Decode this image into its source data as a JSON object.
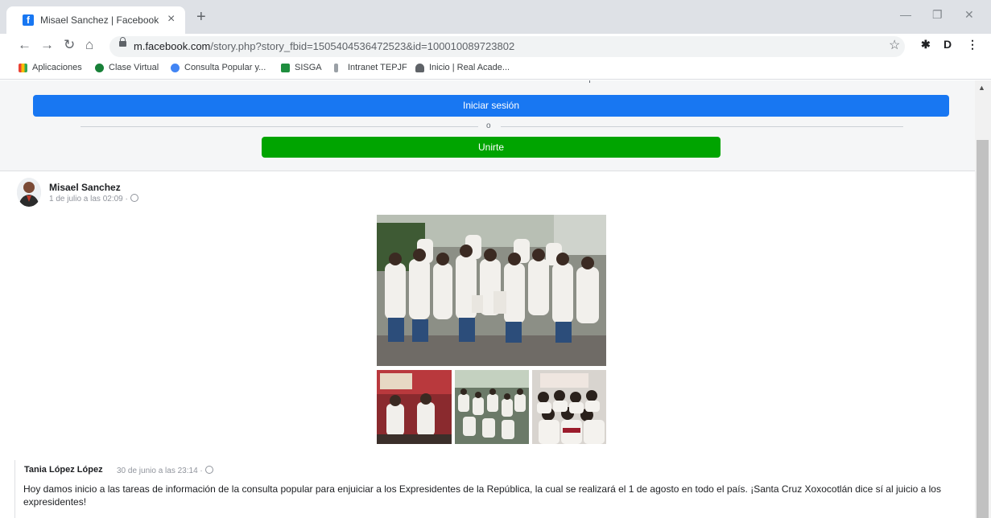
{
  "browser": {
    "tab_title": "Misael Sanchez | Facebook",
    "tab_favicon": "f",
    "url_host": "m.facebook.com",
    "url_path": "/story.php?story_fbid=1505404536472523&id=100010089723802",
    "bookmarks": [
      {
        "label": "Aplicaciones",
        "icon": "apps-grid-icon"
      },
      {
        "label": "Clase Virtual",
        "icon": "classroom-icon"
      },
      {
        "label": "Consulta Popular y...",
        "icon": "globe-icon"
      },
      {
        "label": "SISGA",
        "icon": "sisga-icon"
      },
      {
        "label": "Intranet TEPJF",
        "icon": "tepjf-icon"
      },
      {
        "label": "Inicio | Real Acade...",
        "icon": "rae-icon"
      }
    ],
    "extension_label": "D"
  },
  "login_bar": {
    "login_label": "Iniciar sesión",
    "or_label": "o",
    "join_label": "Unirte",
    "login_color": "#1877f2",
    "join_color": "#00a400"
  },
  "post": {
    "author": "Misael Sanchez",
    "meta": "1 de julio a las 02:09 · ",
    "privacy_icon": "globe-icon",
    "photo_count": 4,
    "quoted": {
      "author": "Tania López López",
      "meta": "30 de junio a las 23:14 · ",
      "text": "Hoy damos inicio a las tareas de información de la consulta popular para enjuiciar a los Expresidentes de la República, la cual se realizará el 1 de agosto en todo el país. ¡Santa Cruz Xoxocotlán dice sí al juicio a los expresidentes!"
    }
  }
}
